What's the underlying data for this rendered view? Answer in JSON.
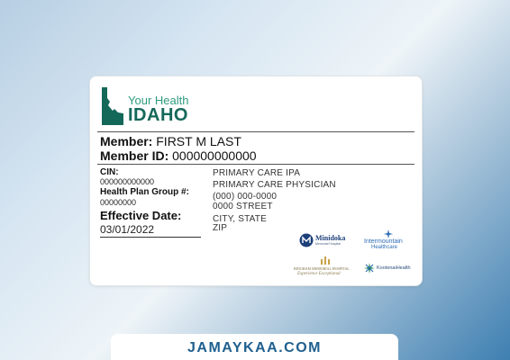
{
  "card": {
    "logo": {
      "line1": "Your Health",
      "line2": "IDAHO"
    },
    "member": {
      "name_label": "Member:",
      "name_value": "FIRST M LAST",
      "id_label": "Member ID:",
      "id_value": "000000000000"
    },
    "cin": {
      "label": "CIN:",
      "value": "000000000000"
    },
    "group": {
      "label": "Health Plan Group #:",
      "value": "00000000"
    },
    "effective": {
      "label": "Effective Date:",
      "value": "03/01/2022"
    },
    "provider": {
      "ipa": "PRIMARY CARE IPA",
      "physician": "PRIMARY CARE PHYSICIAN",
      "phone": "(000) 000-0000",
      "street": "0000 STREET",
      "city_state": "CITY, STATE",
      "zip": "ZIP"
    },
    "partners": {
      "minidoka": "Minidoka",
      "minidoka_sub": "Memorial Hospital",
      "intermountain_1": "Intermountain",
      "intermountain_2": "Healthcare",
      "bingham": "BINGHAM MEMORIAL HOSPITAL",
      "bingham_sub": "Experience Exceptional",
      "kootenai": "KootenaiHealth"
    }
  },
  "banner": {
    "text": "JAMAYKAA.COM"
  },
  "colors": {
    "logo_green_light": "#2e9c7d",
    "logo_green_dark": "#14685a",
    "banner_text": "#1f5f8e"
  }
}
